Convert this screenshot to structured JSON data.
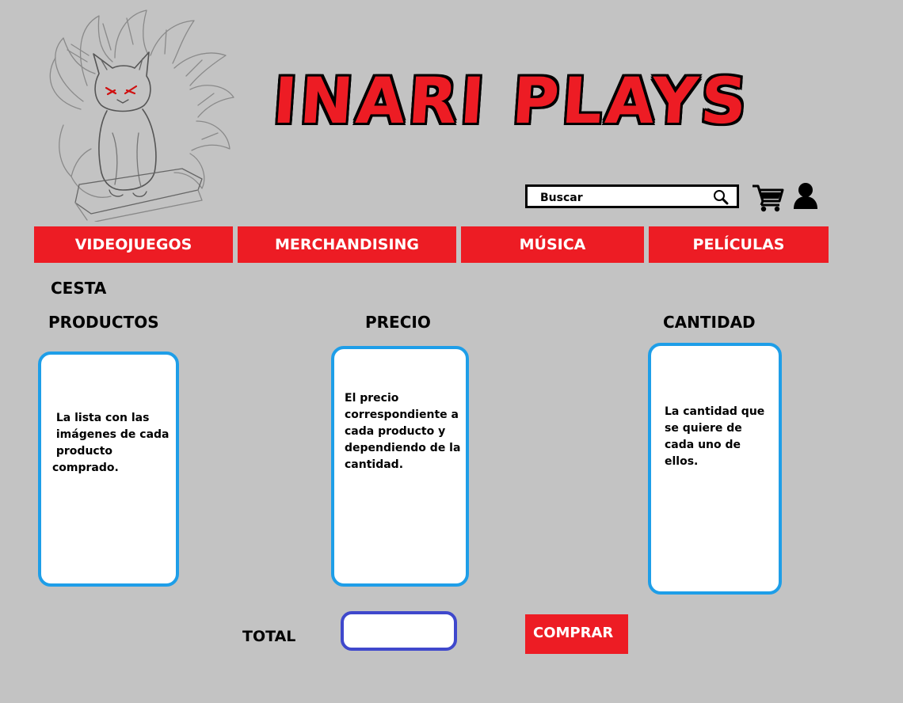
{
  "header": {
    "title": "INARI PLAYS",
    "logo_icon": "fox-logo-icon"
  },
  "search": {
    "placeholder": "Buscar",
    "value": "",
    "icon": "search-icon"
  },
  "header_icons": [
    "cart-icon",
    "user-icon"
  ],
  "nav": {
    "tabs": [
      {
        "label": "VIDEOJUEGOS"
      },
      {
        "label": "MERCHANDISING"
      },
      {
        "label": "MÚSICA"
      },
      {
        "label": "PELÍCULAS"
      }
    ]
  },
  "cart": {
    "heading": "CESTA",
    "columns": [
      {
        "label": "PRODUCTOS",
        "text": " La lista con las\n imágenes de cada\n producto\ncomprado."
      },
      {
        "label": "PRECIO",
        "text": "El precio\ncorrespondiente a\ncada producto y\ndependiendo de la\ncantidad."
      },
      {
        "label": "CANTIDAD",
        "text": "La cantidad que\nse quiere de\ncada uno de\nellos."
      }
    ],
    "total_label": "TOTAL",
    "total_value": "",
    "buy_label": "COMPRAR"
  },
  "colors": {
    "background": "#c3c3c3",
    "accent_red": "#ed1c24",
    "panel_border": "#1e9ee8",
    "total_border": "#3f48cc"
  }
}
